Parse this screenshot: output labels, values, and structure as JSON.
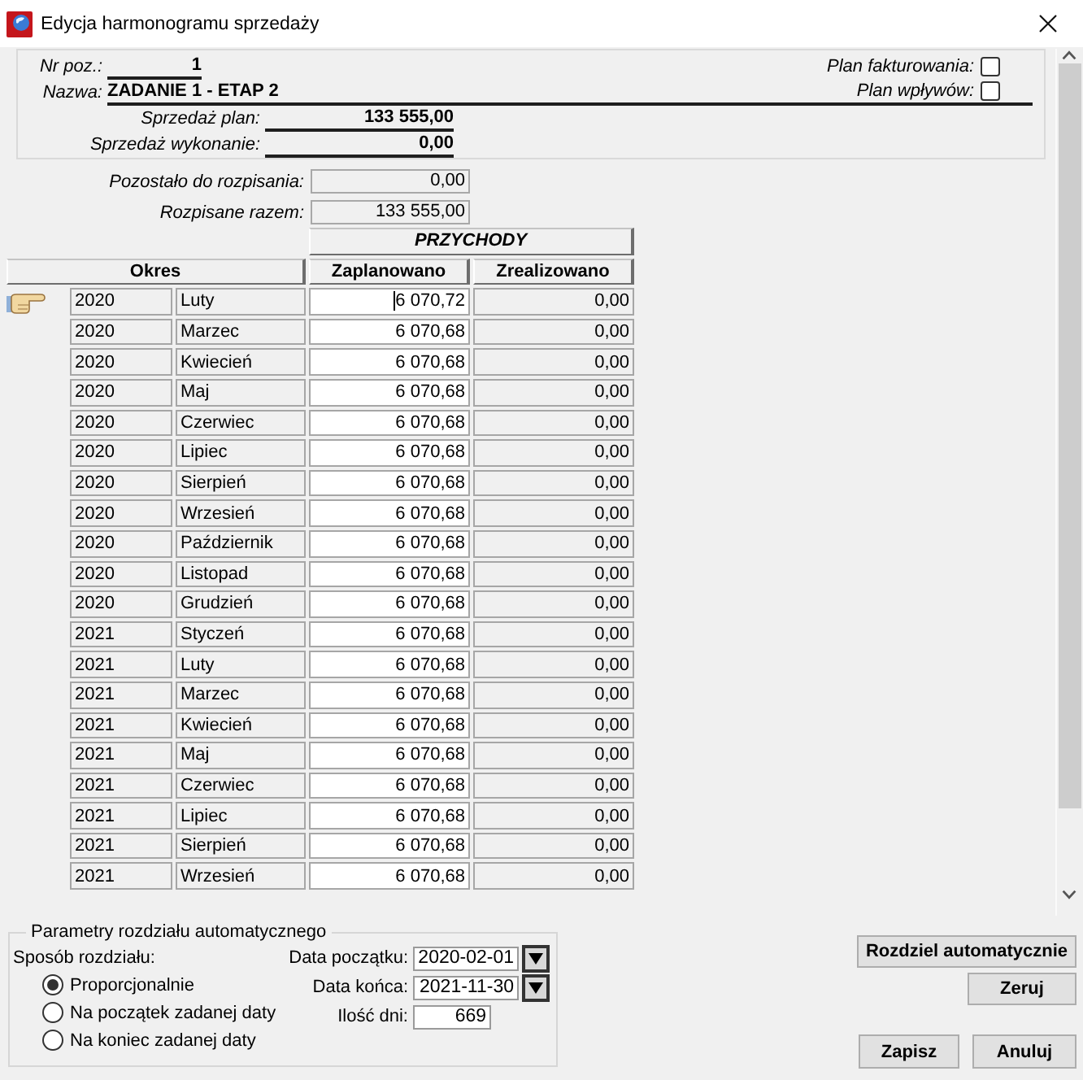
{
  "window": {
    "title": "Edycja harmonogramu sprzedaży"
  },
  "header": {
    "position": {
      "label": "Nr poz.:",
      "value": "1"
    },
    "name": {
      "label": "Nazwa:",
      "value": "ZADANIE 1 - ETAP 2"
    },
    "flags": [
      {
        "label": "Plan fakturowania:",
        "checked": false
      },
      {
        "label": "Plan wpływów:",
        "checked": false
      }
    ],
    "sales": [
      {
        "label": "Sprzedaż plan:",
        "value": "133 555,00"
      },
      {
        "label": "Sprzedaż wykonanie:",
        "value": "0,00"
      }
    ]
  },
  "summary": [
    {
      "label": "Pozostało do rozpisania:",
      "value": "0,00"
    },
    {
      "label": "Rozpisane razem:",
      "value": "133 555,00"
    }
  ],
  "table": {
    "group_heading": "PRZYCHODY",
    "columns": [
      "Okres",
      "Zaplanowano",
      "Zrealizowano"
    ],
    "rows": [
      {
        "year": "2020",
        "month": "Luty",
        "planned": "6 070,72",
        "realized": "0,00",
        "current": true
      },
      {
        "year": "2020",
        "month": "Marzec",
        "planned": "6 070,68",
        "realized": "0,00",
        "current": false
      },
      {
        "year": "2020",
        "month": "Kwiecień",
        "planned": "6 070,68",
        "realized": "0,00",
        "current": false
      },
      {
        "year": "2020",
        "month": "Maj",
        "planned": "6 070,68",
        "realized": "0,00",
        "current": false
      },
      {
        "year": "2020",
        "month": "Czerwiec",
        "planned": "6 070,68",
        "realized": "0,00",
        "current": false
      },
      {
        "year": "2020",
        "month": "Lipiec",
        "planned": "6 070,68",
        "realized": "0,00",
        "current": false
      },
      {
        "year": "2020",
        "month": "Sierpień",
        "planned": "6 070,68",
        "realized": "0,00",
        "current": false
      },
      {
        "year": "2020",
        "month": "Wrzesień",
        "planned": "6 070,68",
        "realized": "0,00",
        "current": false
      },
      {
        "year": "2020",
        "month": "Październik",
        "planned": "6 070,68",
        "realized": "0,00",
        "current": false
      },
      {
        "year": "2020",
        "month": "Listopad",
        "planned": "6 070,68",
        "realized": "0,00",
        "current": false
      },
      {
        "year": "2020",
        "month": "Grudzień",
        "planned": "6 070,68",
        "realized": "0,00",
        "current": false
      },
      {
        "year": "2021",
        "month": "Styczeń",
        "planned": "6 070,68",
        "realized": "0,00",
        "current": false
      },
      {
        "year": "2021",
        "month": "Luty",
        "planned": "6 070,68",
        "realized": "0,00",
        "current": false
      },
      {
        "year": "2021",
        "month": "Marzec",
        "planned": "6 070,68",
        "realized": "0,00",
        "current": false
      },
      {
        "year": "2021",
        "month": "Kwiecień",
        "planned": "6 070,68",
        "realized": "0,00",
        "current": false
      },
      {
        "year": "2021",
        "month": "Maj",
        "planned": "6 070,68",
        "realized": "0,00",
        "current": false
      },
      {
        "year": "2021",
        "month": "Czerwiec",
        "planned": "6 070,68",
        "realized": "0,00",
        "current": false
      },
      {
        "year": "2021",
        "month": "Lipiec",
        "planned": "6 070,68",
        "realized": "0,00",
        "current": false
      },
      {
        "year": "2021",
        "month": "Sierpień",
        "planned": "6 070,68",
        "realized": "0,00",
        "current": false
      },
      {
        "year": "2021",
        "month": "Wrzesień",
        "planned": "6 070,68",
        "realized": "0,00",
        "current": false
      }
    ]
  },
  "auto_distribution": {
    "title": "Parametry rozdziału automatycznego",
    "method_label": "Sposób rozdziału:",
    "methods": [
      {
        "label": "Proporcjonalnie",
        "selected": true
      },
      {
        "label": "Na początek zadanej daty",
        "selected": false
      },
      {
        "label": "Na koniec zadanej daty",
        "selected": false
      }
    ],
    "fields": [
      {
        "kind": "date",
        "label": "Data początku:",
        "value": "2020-02-01"
      },
      {
        "kind": "date",
        "label": "Data końca:",
        "value": "2021-11-30"
      },
      {
        "kind": "number",
        "label": "Ilość dni:",
        "value": "669"
      }
    ]
  },
  "buttons": {
    "distribute": "Rozdziel automatycznie",
    "reset": "Zeruj",
    "save": "Zapisz",
    "cancel": "Anuluj"
  }
}
